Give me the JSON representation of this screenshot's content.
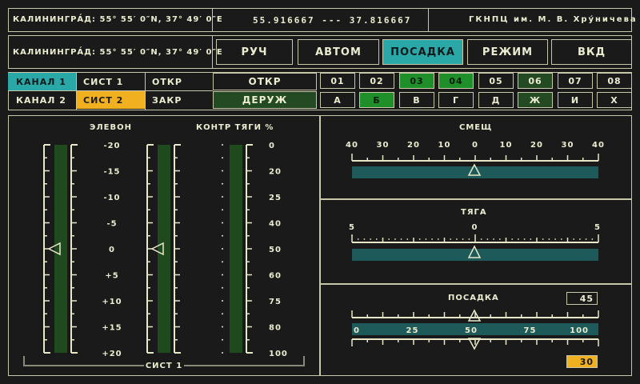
{
  "header": {
    "location_left": "КАЛИНИНГРА́Д: 55° 55′ 0″N, 37° 49′ 0″E",
    "coords": "55.916667 --- 37.816667",
    "org": "ГКНПЦ им. М. В. Хру́ничева",
    "location_row2": "КАЛИНИНГРА́Д: 55° 55′ 0″N, 37° 49′ 0″E"
  },
  "modes": [
    "РУЧ",
    "АВТОМ",
    "ПОСАДКА",
    "РЕЖИМ",
    "ВКД"
  ],
  "active_mode": "ПОСАДКА",
  "channels": {
    "ch1": "КАНАЛ 1",
    "ch2": "КАНАЛ 2",
    "sys1": "СИСТ 1",
    "sys2": "СИСТ 2",
    "otkr": "ОТКР",
    "zakr": "ЗАКР",
    "otkr_btn": "ОТКР",
    "deruzh_btn": "ДЕРУЖ"
  },
  "numbers": [
    "01",
    "02",
    "03",
    "04",
    "05",
    "06",
    "07",
    "08"
  ],
  "letters": [
    "А",
    "Б",
    "В",
    "Г",
    "Д",
    "Ж",
    "И",
    "Х"
  ],
  "left": {
    "elevon_title": "ЭЛЕВОН",
    "thrust_title": "КОНТР ТЯГИ %",
    "elevon_ticks": [
      "-20",
      "-15",
      "-10",
      "-5",
      "0",
      "+5",
      "+10",
      "+15",
      "+20"
    ],
    "thrust_ticks": [
      "0",
      "20",
      "25",
      "40",
      "50",
      "60",
      "75",
      "80",
      "100"
    ],
    "bottom_label": "СИСТ 1"
  },
  "smesch": {
    "title": "СМЕЩ",
    "ticks": [
      "40",
      "30",
      "20",
      "10",
      "0",
      "10",
      "20",
      "30",
      "40"
    ]
  },
  "tyaga": {
    "title": "ТЯГА",
    "ticks": [
      "5",
      "0",
      "5"
    ]
  },
  "posadka": {
    "title": "ПОСАДКА",
    "upper_value": "45",
    "lower_value": "30",
    "ticks": [
      "0",
      "25",
      "50",
      "75",
      "100"
    ]
  },
  "colors": {
    "teal": "#2aa8a8",
    "yellow": "#f0b020",
    "green": "#1f8f2a",
    "dark_green": "#234a23",
    "bar_teal": "#1e5a5a",
    "gauge_green": "#1e4a1e"
  }
}
